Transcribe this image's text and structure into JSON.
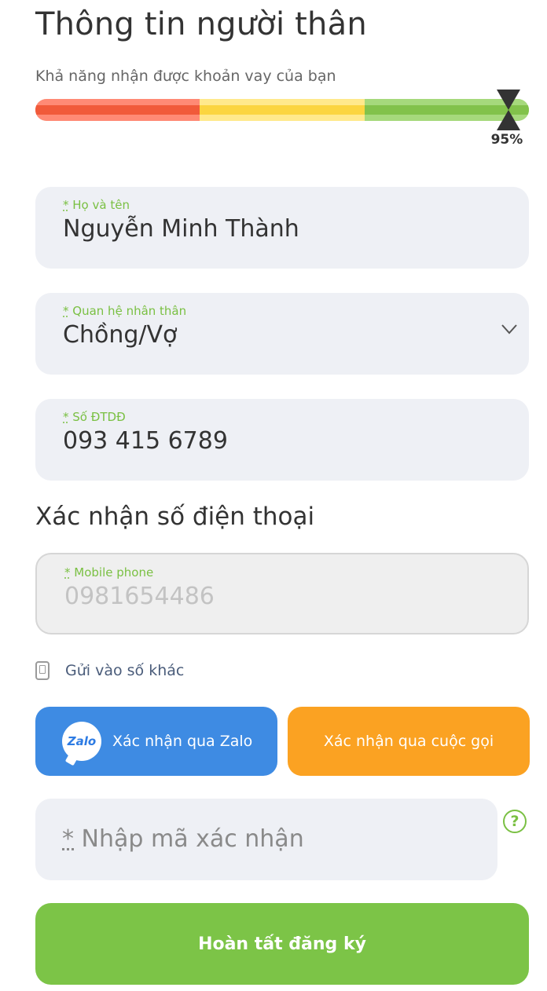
{
  "header": {
    "title": "Thông tin người thân",
    "subtitle": "Khả năng nhận được khoản vay của bạn"
  },
  "loan_score": {
    "percent_label": "95%",
    "value_fraction": 0.95,
    "colors": {
      "low": "#f15a3a",
      "mid": "#fbd540",
      "high": "#82c24b"
    }
  },
  "fields": {
    "full_name": {
      "required_mark": "*",
      "label": "Họ và tên",
      "value": "Nguyễn Minh Thành"
    },
    "relationship": {
      "required_mark": "*",
      "label": "Quan hệ nhân thân",
      "value": "Chồng/Vợ",
      "icon": "chevron-down-icon"
    },
    "phone": {
      "required_mark": "*",
      "label": "Số ĐTDĐ",
      "value": "093 415 6789"
    }
  },
  "verification": {
    "title": "Xác nhận số điện thoại",
    "mobile": {
      "required_mark": "*",
      "label": "Mobile phone",
      "value": "0981654486"
    },
    "send_other_label": "Gửi vào số khác",
    "zalo_icon_text": "Zalo",
    "zalo_button": "Xác nhận qua Zalo",
    "call_button": "Xác nhận qua cuộc gọi",
    "code": {
      "required_mark": "*",
      "placeholder": "Nhập mã xác nhận"
    },
    "help_icon": "?"
  },
  "submit_label": "Hoàn tất đăng ký",
  "colors": {
    "accent": "#7cc447",
    "zalo": "#3e8be3",
    "call": "#fba222"
  }
}
